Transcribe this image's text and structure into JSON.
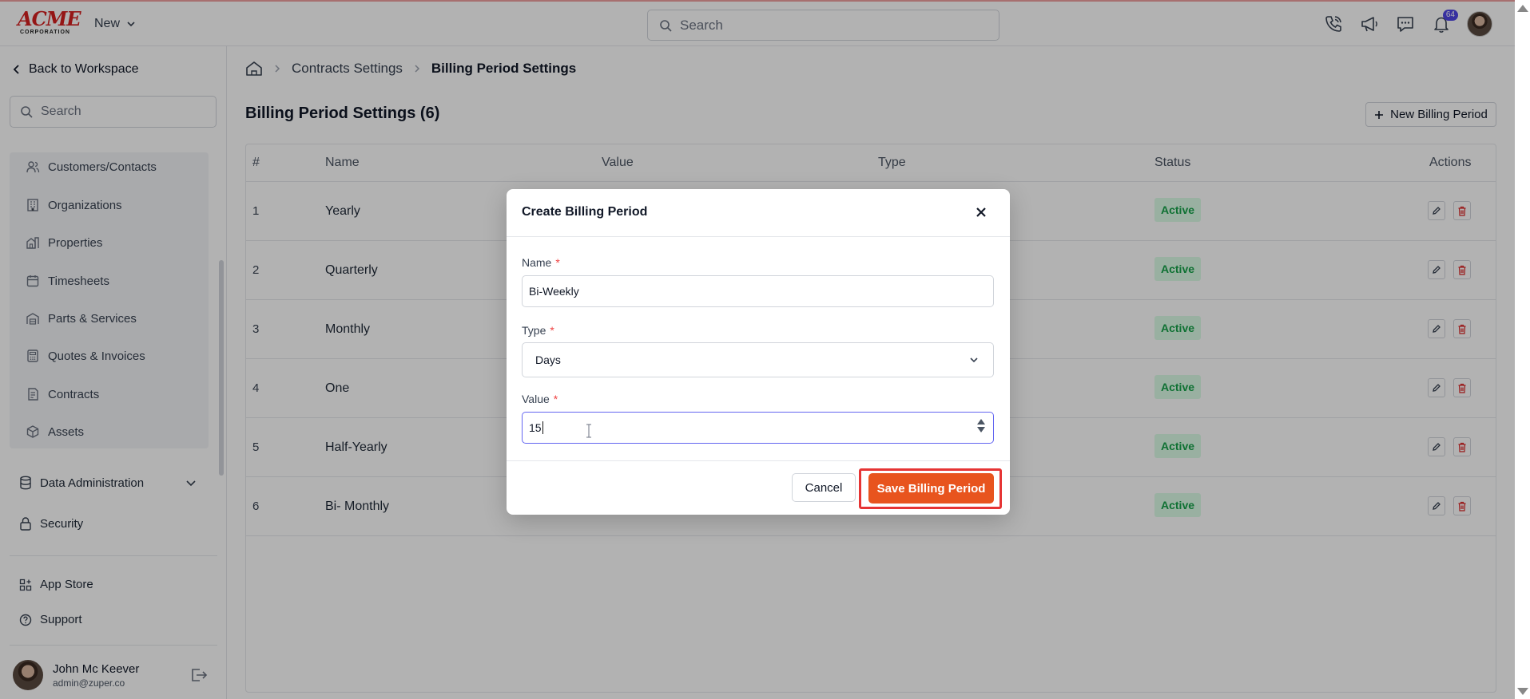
{
  "header": {
    "logo_main": "ACME",
    "logo_sub": "CORPORATION",
    "new_menu_label": "New",
    "search_placeholder": "Search",
    "notification_count": "64"
  },
  "sidebar": {
    "back_label": "Back to Workspace",
    "search_placeholder": "Search",
    "items": [
      {
        "label": "Customers/Contacts",
        "icon": "users-icon"
      },
      {
        "label": "Organizations",
        "icon": "building-icon"
      },
      {
        "label": "Properties",
        "icon": "property-icon"
      },
      {
        "label": "Timesheets",
        "icon": "calendar-icon"
      },
      {
        "label": "Parts & Services",
        "icon": "warehouse-icon"
      },
      {
        "label": "Quotes & Invoices",
        "icon": "calculator-icon"
      },
      {
        "label": "Contracts",
        "icon": "contract-icon"
      },
      {
        "label": "Assets",
        "icon": "cube-icon"
      }
    ],
    "data_admin_label": "Data Administration",
    "security_label": "Security",
    "app_store_label": "App Store",
    "support_label": "Support",
    "user": {
      "name": "John Mc Keever",
      "email": "admin@zuper.co"
    }
  },
  "breadcrumb": {
    "level1": "Contracts Settings",
    "level2": "Billing Period Settings"
  },
  "page": {
    "title": "Billing Period Settings (6)",
    "new_button_label": "New Billing Period"
  },
  "table": {
    "headers": {
      "num": "#",
      "name": "Name",
      "value": "Value",
      "type": "Type",
      "status": "Status",
      "actions": "Actions"
    },
    "rows": [
      {
        "num": "1",
        "name": "Yearly",
        "status": "Active"
      },
      {
        "num": "2",
        "name": "Quarterly",
        "status": "Active"
      },
      {
        "num": "3",
        "name": "Monthly",
        "status": "Active"
      },
      {
        "num": "4",
        "name": "One",
        "status": "Active"
      },
      {
        "num": "5",
        "name": "Half-Yearly",
        "status": "Active"
      },
      {
        "num": "6",
        "name": "Bi- Monthly",
        "status": "Active"
      }
    ]
  },
  "modal": {
    "title": "Create Billing Period",
    "name_label": "Name",
    "name_value": "Bi-Weekly",
    "type_label": "Type",
    "type_value": "Days",
    "value_label": "Value",
    "value_value": "15",
    "required_mark": "*",
    "cancel_label": "Cancel",
    "save_label": "Save Billing Period"
  },
  "colors": {
    "accent": "#e8541e",
    "highlight": "#e63434",
    "active_badge": "#16a34a",
    "focus_ring": "#6366f1"
  }
}
